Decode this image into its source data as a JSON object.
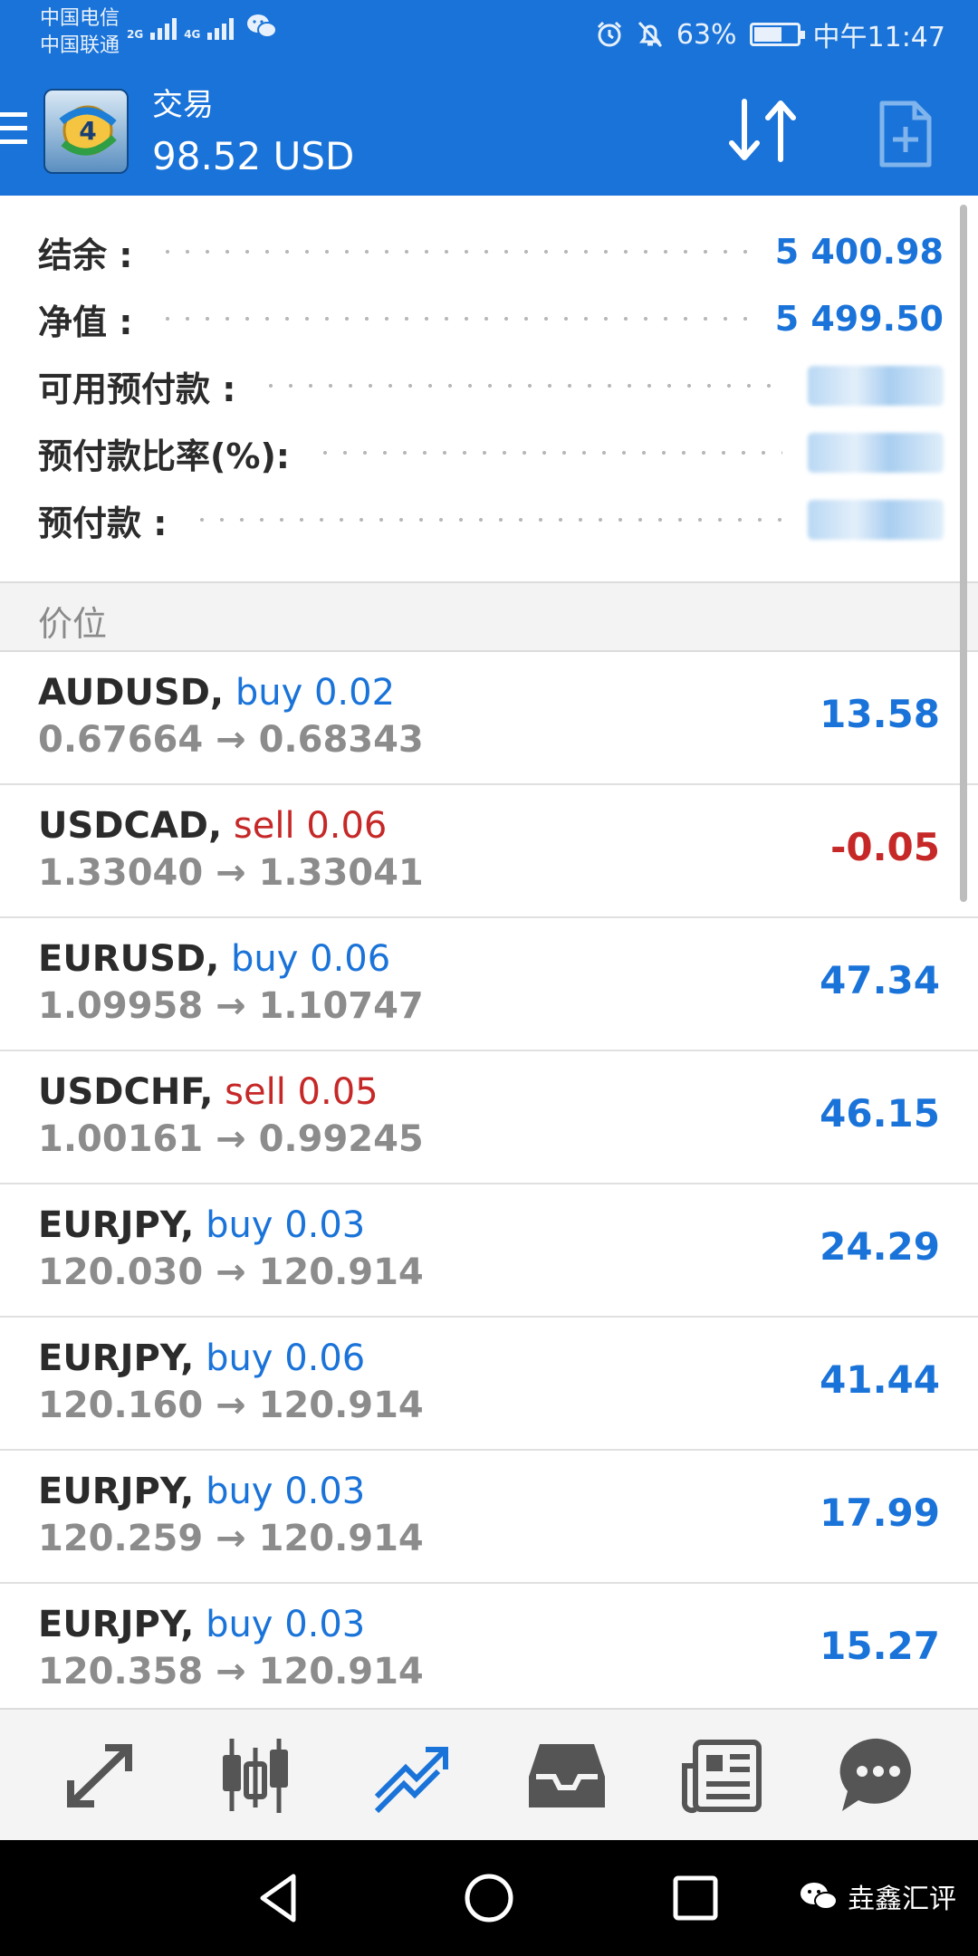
{
  "status_bar": {
    "carrier_1": "中国电信",
    "carrier_2": "中国联通",
    "net_1": "2G",
    "net_2": "4G",
    "battery": "63%",
    "time": "中午11:47",
    "icons": [
      "alarm-icon",
      "bell-off-icon",
      "battery-icon",
      "wechat-icon"
    ]
  },
  "toolbar": {
    "title": "交易",
    "balance_display": "98.52 USD"
  },
  "summary": [
    {
      "label": "结余 :",
      "value": "5 400.98"
    },
    {
      "label": "净值 :",
      "value": "5 499.50"
    },
    {
      "label": "可用预付款 :",
      "value": ""
    },
    {
      "label": "预付款比率(%):",
      "value": ""
    },
    {
      "label": "预付款 :",
      "value": ""
    }
  ],
  "section": {
    "title": "价位"
  },
  "positions": [
    {
      "symbol": "AUDUSD,",
      "direction": "buy",
      "volume_text": "buy 0.02",
      "open": "0.67664",
      "arrow": "→",
      "current": "0.68343",
      "profit": "13.58"
    },
    {
      "symbol": "USDCAD,",
      "direction": "sell",
      "volume_text": "sell 0.06",
      "open": "1.33040",
      "arrow": "→",
      "current": "1.33041",
      "profit": "-0.05"
    },
    {
      "symbol": "EURUSD,",
      "direction": "buy",
      "volume_text": "buy 0.06",
      "open": "1.09958",
      "arrow": "→",
      "current": "1.10747",
      "profit": "47.34"
    },
    {
      "symbol": "USDCHF,",
      "direction": "sell",
      "volume_text": "sell 0.05",
      "open": "1.00161",
      "arrow": "→",
      "current": "0.99245",
      "profit": "46.15"
    },
    {
      "symbol": "EURJPY,",
      "direction": "buy",
      "volume_text": "buy 0.03",
      "open": "120.030",
      "arrow": "→",
      "current": "120.914",
      "profit": "24.29"
    },
    {
      "symbol": "EURJPY,",
      "direction": "buy",
      "volume_text": "buy 0.06",
      "open": "120.160",
      "arrow": "→",
      "current": "120.914",
      "profit": "41.44"
    },
    {
      "symbol": "EURJPY,",
      "direction": "buy",
      "volume_text": "buy 0.03",
      "open": "120.259",
      "arrow": "→",
      "current": "120.914",
      "profit": "17.99"
    },
    {
      "symbol": "EURJPY,",
      "direction": "buy",
      "volume_text": "buy 0.03",
      "open": "120.358",
      "arrow": "→",
      "current": "120.914",
      "profit": "15.27"
    }
  ],
  "bottom_nav": [
    {
      "name": "quotes-icon",
      "active": false
    },
    {
      "name": "chart-icon",
      "active": false
    },
    {
      "name": "trade-icon",
      "active": true
    },
    {
      "name": "history-icon",
      "active": false
    },
    {
      "name": "news-icon",
      "active": false
    },
    {
      "name": "chat-icon",
      "active": false
    }
  ],
  "colors": {
    "accent": "#1a73d9",
    "sell": "#c62828",
    "text": "#2b2b2b",
    "muted": "#8c8c8c"
  },
  "watermark": {
    "text": "垚鑫汇评"
  }
}
